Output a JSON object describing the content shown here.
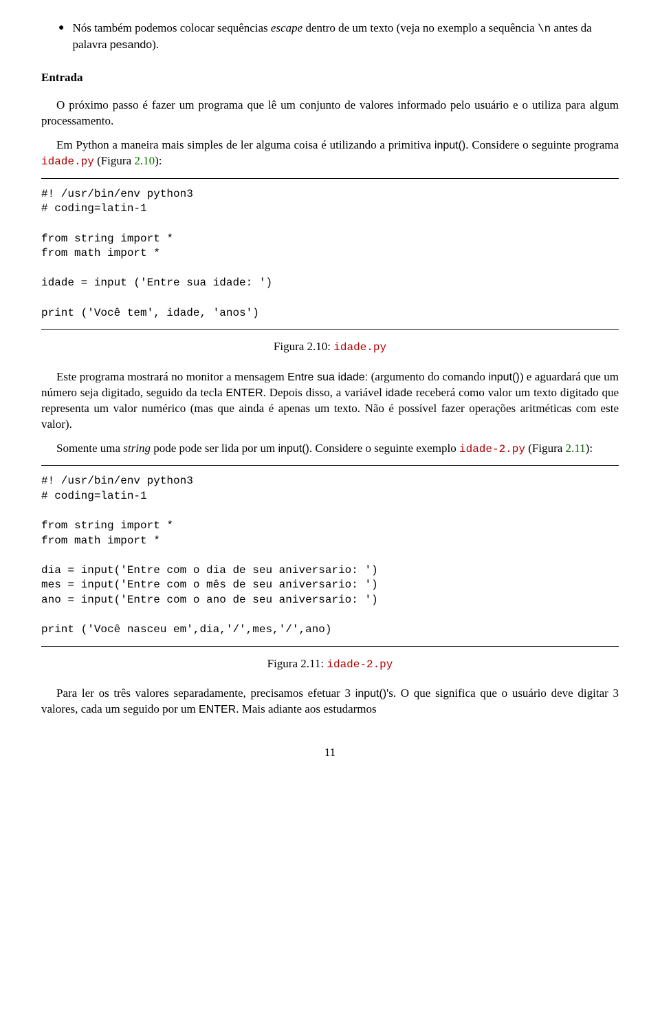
{
  "bullet1": {
    "prefix": "Nós também podemos colocar sequências ",
    "escape_word": "escape",
    "middle": " dentro de um texto (veja no exemplo a sequência ",
    "seq": "\\n",
    "suffix1": " antes da palavra ",
    "pesando": "pesando",
    "closeparen": ")."
  },
  "heading_entrada": "Entrada",
  "para1": "O próximo passo é fazer um programa que lê um conjunto de valores informado pelo usuário e o utiliza para algum processamento.",
  "para2": {
    "p1": "Em Python a maneira mais simples de ler alguma coisa é utilizando a primitiva ",
    "input": "input()",
    "p2": ". Considere o seguinte programa ",
    "idadepy": "idade.py",
    "p3": " (Figura ",
    "ref": "2.10",
    "p4": "):"
  },
  "code1": "#! /usr/bin/env python3\n# coding=latin-1\n\nfrom string import *\nfrom math import *\n\nidade = input ('Entre sua idade: ')\n\nprint ('Você tem', idade, 'anos')",
  "caption1": {
    "label": "Figura 2.10: ",
    "file": "idade.py"
  },
  "para3": {
    "p1": "Este programa mostrará no monitor a mensagem ",
    "enter_msg": "Entre sua idade:",
    "p2": " (argumento do comando ",
    "input": "input()",
    "p3": ") e aguardará que um número seja digitado, seguido da tecla ",
    "enter": "ENTER",
    "p4": ". Depois disso, a variável ",
    "idade": "idade",
    "p5": " receberá como valor um texto digitado que representa um valor numérico (mas que ainda é apenas um texto. Não é possível fazer operações aritméticas com este valor)."
  },
  "para4": {
    "p1": "Somente uma ",
    "string_w": "string",
    "p2": " pode pode ser lida por um ",
    "input": "input()",
    "p3": ".  Considere o seguinte exemplo ",
    "file": "idade-2.py",
    "p4": " (Figura ",
    "ref": "2.11",
    "p5": "):"
  },
  "code2": "#! /usr/bin/env python3\n# coding=latin-1\n\nfrom string import *\nfrom math import *\n\ndia = input('Entre com o dia de seu aniversario: ')\nmes = input('Entre com o mês de seu aniversario: ')\nano = input('Entre com o ano de seu aniversario: ')\n\nprint ('Você nasceu em',dia,'/',mes,'/',ano)",
  "caption2": {
    "label": "Figura 2.11: ",
    "file": "idade-2.py"
  },
  "para5": {
    "p1": "Para ler os três valores separadamente, precisamos efetuar 3 ",
    "input": "input()",
    "p2": "'s. O que significa que o usuário deve digitar 3 valores, cada um seguido por um ",
    "enter": "ENTER",
    "p3": ". Mais adiante aos estudarmos"
  },
  "page_no": "11"
}
